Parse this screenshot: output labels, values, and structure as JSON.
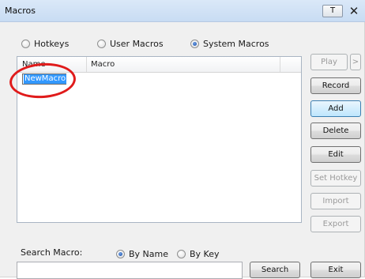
{
  "window": {
    "title": "Macros",
    "pin_label": "T",
    "close_glyph": "✕"
  },
  "mode": {
    "options": [
      "Hotkeys",
      "User Macros",
      "System Macros"
    ],
    "selected": "System Macros"
  },
  "list": {
    "columns": [
      "Name",
      "Macro"
    ],
    "editing_value": "NewMacro"
  },
  "buttons": {
    "play": "Play",
    "play_more": ">",
    "record": "Record",
    "add": "Add",
    "delete": "Delete",
    "edit": "Edit",
    "set_hotkey": "Set Hotkey",
    "import": "Import",
    "export": "Export",
    "search": "Search",
    "exit": "Exit"
  },
  "search": {
    "label": "Search Macro:",
    "options": [
      "By Name",
      "By Key"
    ],
    "selected": "By Name",
    "value": ""
  },
  "colors": {
    "annotation": "#e01b1b",
    "selection": "#3399ff"
  }
}
